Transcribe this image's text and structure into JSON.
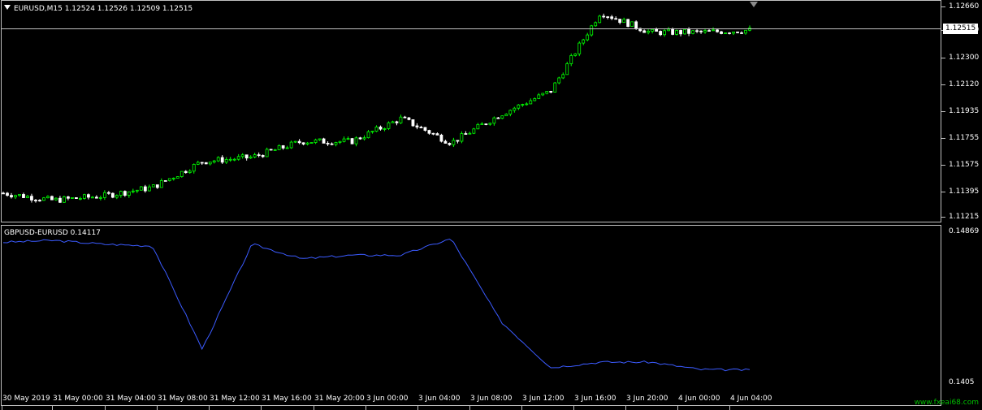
{
  "main_pane": {
    "title": "EURUSD,M15  1.12524 1.12526 1.12509 1.12515",
    "current_price": "1.12515",
    "price_axis": [
      "1.12660",
      "1.12480",
      "1.12300",
      "1.12120",
      "1.11935",
      "1.11755",
      "1.11575",
      "1.11395",
      "1.11215"
    ],
    "bull_color": "#00ff00",
    "bear_color": "#ffffff"
  },
  "indicator_pane": {
    "title": "GBPUSD-EURUSD 0.14117",
    "axis": [
      "0.14869",
      "0.1405"
    ],
    "line_color": "#3b5bff"
  },
  "time_axis": [
    "30 May 2019",
    "31 May 00:00",
    "31 May 04:00",
    "31 May 08:00",
    "31 May 12:00",
    "31 May 16:00",
    "31 May 20:00",
    "3 Jun 00:00",
    "3 Jun 04:00",
    "3 Jun 08:00",
    "3 Jun 12:00",
    "3 Jun 16:00",
    "3 Jun 20:00",
    "4 Jun 00:00",
    "4 Jun 04:00"
  ],
  "watermark": "www.fxeai68.com",
  "chart_data": [
    {
      "type": "line",
      "title": "EURUSD,M15",
      "ylim": [
        1.11215,
        1.1268
      ],
      "x": [
        "30 May 2019",
        "31 May 00:00",
        "31 May 04:00",
        "31 May 08:00",
        "31 May 12:00",
        "31 May 16:00",
        "31 May 20:00",
        "3 Jun 00:00",
        "3 Jun 04:00",
        "3 Jun 08:00",
        "3 Jun 12:00",
        "3 Jun 16:00",
        "3 Jun 20:00",
        "4 Jun 00:00",
        "4 Jun 04:00",
        "4 Jun 05:00"
      ],
      "series": [
        {
          "name": "EURUSD",
          "values": [
            1.1138,
            1.1133,
            1.1136,
            1.1142,
            1.116,
            1.1163,
            1.1174,
            1.1174,
            1.119,
            1.1173,
            1.1193,
            1.1209,
            1.1264,
            1.125,
            1.125,
            1.12515
          ]
        }
      ]
    },
    {
      "type": "line",
      "title": "GBPUSD-EURUSD",
      "ylim": [
        0.1405,
        0.14869
      ],
      "x": [
        "30 May 2019",
        "31 May 00:00",
        "31 May 04:00",
        "31 May 08:00",
        "31 May 12:00",
        "31 May 16:00",
        "31 May 20:00",
        "3 Jun 00:00",
        "3 Jun 04:00",
        "3 Jun 08:00",
        "3 Jun 12:00",
        "3 Jun 16:00",
        "3 Jun 20:00",
        "4 Jun 00:00",
        "4 Jun 04:00",
        "4 Jun 05:00"
      ],
      "series": [
        {
          "name": "GBPUSD-EURUSD",
          "values": [
            0.1481,
            0.1482,
            0.148,
            0.1479,
            0.1423,
            0.148,
            0.1472,
            0.1474,
            0.1474,
            0.1483,
            0.1438,
            0.1413,
            0.1416,
            0.1416,
            0.1412,
            0.14117
          ]
        }
      ]
    }
  ]
}
